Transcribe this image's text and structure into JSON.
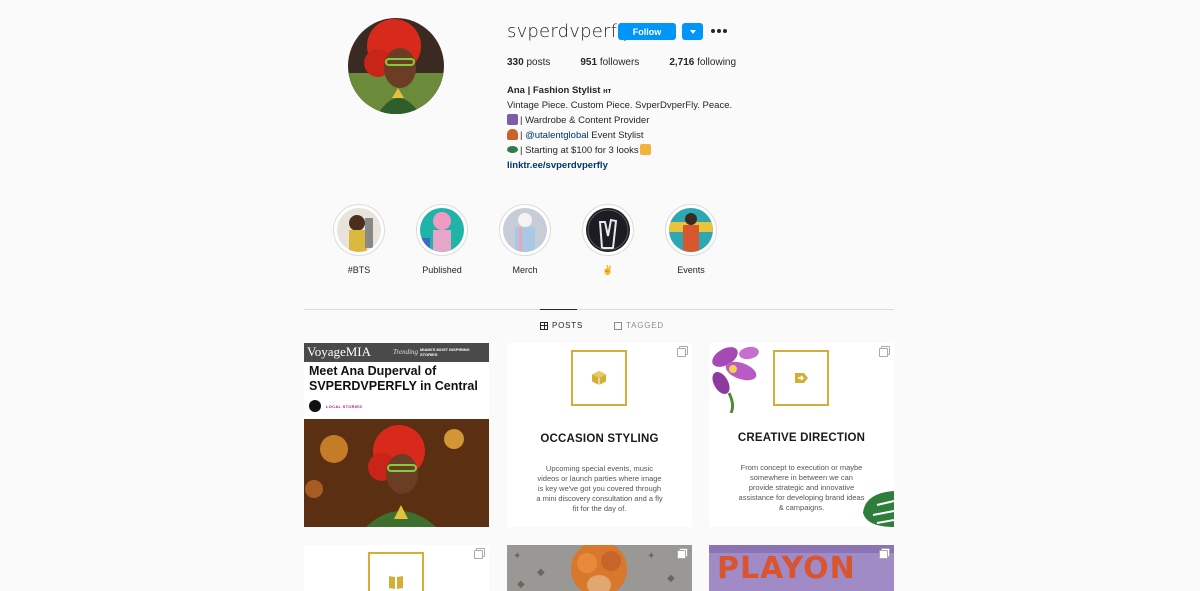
{
  "profile": {
    "username": "svperdvperfly",
    "follow_label": "Follow",
    "stats": {
      "posts_count": "330",
      "posts_label": "posts",
      "followers_count": "951",
      "followers_label": "followers",
      "following_count": "2,716",
      "following_label": "following"
    },
    "bio": {
      "name": "Ana | Fashion Stylist",
      "name_suffix": "ʜᴛ",
      "line1": "Vintage Piece. Custom Piece. SvperDvperFly. Peace.",
      "line2": "| Wardrobe & Content Provider",
      "line3_prefix": "|",
      "line3_mention": "@utalentglobal",
      "line3_suffix": "Event Stylist",
      "line4": "| Starting at $100 for 3 looks",
      "link": "linktr.ee/svperdvperfly"
    }
  },
  "highlights": [
    {
      "label": "#BTS"
    },
    {
      "label": "Published"
    },
    {
      "label": "Merch"
    },
    {
      "label": "✌"
    },
    {
      "label": "Events"
    }
  ],
  "tabs": [
    {
      "label": "POSTS",
      "icon": "grid-icon"
    },
    {
      "label": "TAGGED",
      "icon": "tag-icon"
    }
  ],
  "posts": {
    "p1": {
      "logo": "VoyageMIA",
      "trending": "Trending",
      "subtitle": "MIAMI'S MOST INSPIRING STORIES",
      "headline": "Meet Ana Duperval of SVPERDVPERFLY in Central",
      "section": "LOCAL STORIES"
    },
    "p2": {
      "title": "OCCASION STYLING",
      "desc": "Upcoming special events, music videos or launch parties where image is key we've got you covered through a mini discovery consultation and a fly fit for the day of."
    },
    "p3": {
      "title": "CREATIVE DIRECTION",
      "desc": "From concept to execution or maybe somewhere in between we can provide strategic and innovative assistance for developing brand ideas & campaigns."
    },
    "p6": {
      "title": "PLAYON"
    }
  },
  "colors": {
    "accent": "#0095f6",
    "gold": "#d4af37",
    "link": "#00376b"
  }
}
